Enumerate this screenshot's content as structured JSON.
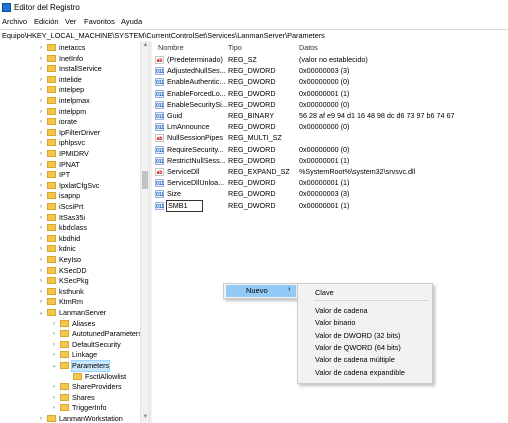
{
  "window": {
    "title": "Editor del Registro"
  },
  "menu": [
    "Archivo",
    "Edición",
    "Ver",
    "Favoritos",
    "Ayuda"
  ],
  "address": "Equipo\\HKEY_LOCAL_MACHINE\\SYSTEM\\CurrentControlSet\\Services\\LanmanServer\\Parameters",
  "tree": [
    {
      "label": "inetaccs"
    },
    {
      "label": "InetInfo"
    },
    {
      "label": "InstallService"
    },
    {
      "label": "intelide"
    },
    {
      "label": "intelpep"
    },
    {
      "label": "intelpmax"
    },
    {
      "label": "intelppm"
    },
    {
      "label": "iorate"
    },
    {
      "label": "IpFilterDriver"
    },
    {
      "label": "iphlpsvc"
    },
    {
      "label": "IPMIDRV"
    },
    {
      "label": "IPNAT"
    },
    {
      "label": "IPT"
    },
    {
      "label": "IpxlatCfgSvc"
    },
    {
      "label": "isapnp"
    },
    {
      "label": "iScsiPrt"
    },
    {
      "label": "ItSas35i"
    },
    {
      "label": "kbdclass"
    },
    {
      "label": "kbdhid"
    },
    {
      "label": "kdnic"
    },
    {
      "label": "KeyIso"
    },
    {
      "label": "KSecDD"
    },
    {
      "label": "KSecPkg"
    },
    {
      "label": "ksthunk"
    },
    {
      "label": "KtmRm"
    },
    {
      "label": "LanmanServer"
    },
    {
      "label": "Aliases"
    },
    {
      "label": "AutotunedParameters"
    },
    {
      "label": "DefaultSecurity"
    },
    {
      "label": "Linkage"
    },
    {
      "label": "Parameters"
    },
    {
      "label": "FsctlAllowlist"
    },
    {
      "label": "ShareProviders"
    },
    {
      "label": "Shares"
    },
    {
      "label": "TriggerInfo"
    },
    {
      "label": "LanmanWorkstation"
    }
  ],
  "columns": {
    "name": "Nombre",
    "type": "Tipo",
    "data": "Datos"
  },
  "values": [
    {
      "icon": "string-value-icon",
      "name": "(Predeterminado)",
      "type": "REG_SZ",
      "data": "(valor no establecido)"
    },
    {
      "icon": "binary-value-icon",
      "name": "AdjustedNullSes...",
      "type": "REG_DWORD",
      "data": "0x00000003 (3)"
    },
    {
      "icon": "binary-value-icon",
      "name": "EnableAuthentic...",
      "type": "REG_DWORD",
      "data": "0x00000000 (0)"
    },
    {
      "icon": "binary-value-icon",
      "name": "EnableForcedLo...",
      "type": "REG_DWORD",
      "data": "0x00000001 (1)"
    },
    {
      "icon": "binary-value-icon",
      "name": "EnableSecuritySi...",
      "type": "REG_DWORD",
      "data": "0x00000000 (0)"
    },
    {
      "icon": "binary-value-icon",
      "name": "Guid",
      "type": "REG_BINARY",
      "data": "56 28 af e9 94 d1 16 48 98 dc d6 73 97 b6 74 67"
    },
    {
      "icon": "binary-value-icon",
      "name": "LmAnnounce",
      "type": "REG_DWORD",
      "data": "0x00000000 (0)"
    },
    {
      "icon": "string-value-icon",
      "name": "NullSessionPipes",
      "type": "REG_MULTI_SZ",
      "data": ""
    },
    {
      "icon": "binary-value-icon",
      "name": "RequireSecurity...",
      "type": "REG_DWORD",
      "data": "0x00000000 (0)"
    },
    {
      "icon": "binary-value-icon",
      "name": "RestrictNullSess...",
      "type": "REG_DWORD",
      "data": "0x00000001 (1)"
    },
    {
      "icon": "string-value-icon",
      "name": "ServiceDll",
      "type": "REG_EXPAND_SZ",
      "data": "%SystemRoot%\\system32\\srvsvc.dll"
    },
    {
      "icon": "binary-value-icon",
      "name": "ServiceDllUnloa...",
      "type": "REG_DWORD",
      "data": "0x00000001 (1)"
    },
    {
      "icon": "binary-value-icon",
      "name": "Size",
      "type": "REG_DWORD",
      "data": "0x00000003 (3)"
    },
    {
      "icon": "binary-value-icon",
      "name": "SMB1",
      "type": "REG_DWORD",
      "data": "0x00000001 (1)"
    }
  ],
  "context_menu": {
    "nuevo": "Nuevo"
  },
  "submenu": {
    "clave": "Clave",
    "items": [
      "Valor de cadena",
      "Valor binario",
      "Valor de DWORD (32 bits)",
      "Valor de QWORD (64 bits)",
      "Valor de cadena múltiple",
      "Valor de cadena expandible"
    ]
  }
}
